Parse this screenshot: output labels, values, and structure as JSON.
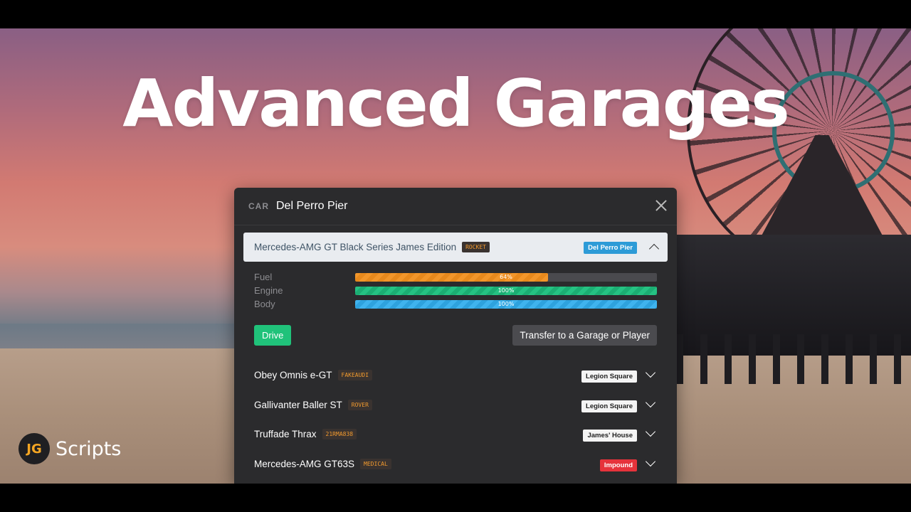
{
  "hero": {
    "title": "Advanced Garages"
  },
  "brand": {
    "logo": "JG",
    "name": "Scripts"
  },
  "panel": {
    "category": "CAR",
    "title": "Del Perro Pier",
    "close_icon": "close-icon"
  },
  "expanded_vehicle": {
    "name": "Mercedes-AMG GT Black Series James Edition",
    "plate": "ROCKET",
    "location": "Del Perro Pier",
    "location_color": "#2d9bd7",
    "stats": [
      {
        "label": "Fuel",
        "value": 0.64,
        "text": "64%",
        "color": "#f2962a"
      },
      {
        "label": "Engine",
        "value": 1.0,
        "text": "100%",
        "color": "#25c283"
      },
      {
        "label": "Body",
        "value": 1.0,
        "text": "100%",
        "color": "#3fb3ee"
      }
    ],
    "drive_label": "Drive",
    "transfer_label": "Transfer to a Garage or Player"
  },
  "vehicles": [
    {
      "name": "Obey Omnis e-GT",
      "plate": "FAKEAUDI",
      "location": "Legion Square",
      "status": "normal"
    },
    {
      "name": "Gallivanter Baller ST",
      "plate": "ROVER",
      "location": "Legion Square",
      "status": "normal"
    },
    {
      "name": "Truffade Thrax",
      "plate": "21RMA838",
      "location": "James' House",
      "status": "normal"
    },
    {
      "name": "Mercedes-AMG GT63S",
      "plate": "MEDICAL",
      "location": "Impound",
      "status": "impound"
    }
  ],
  "colors": {
    "accent_green": "#20c27a",
    "impound_red": "#e6333b",
    "panel_bg": "#2b2b2d"
  }
}
